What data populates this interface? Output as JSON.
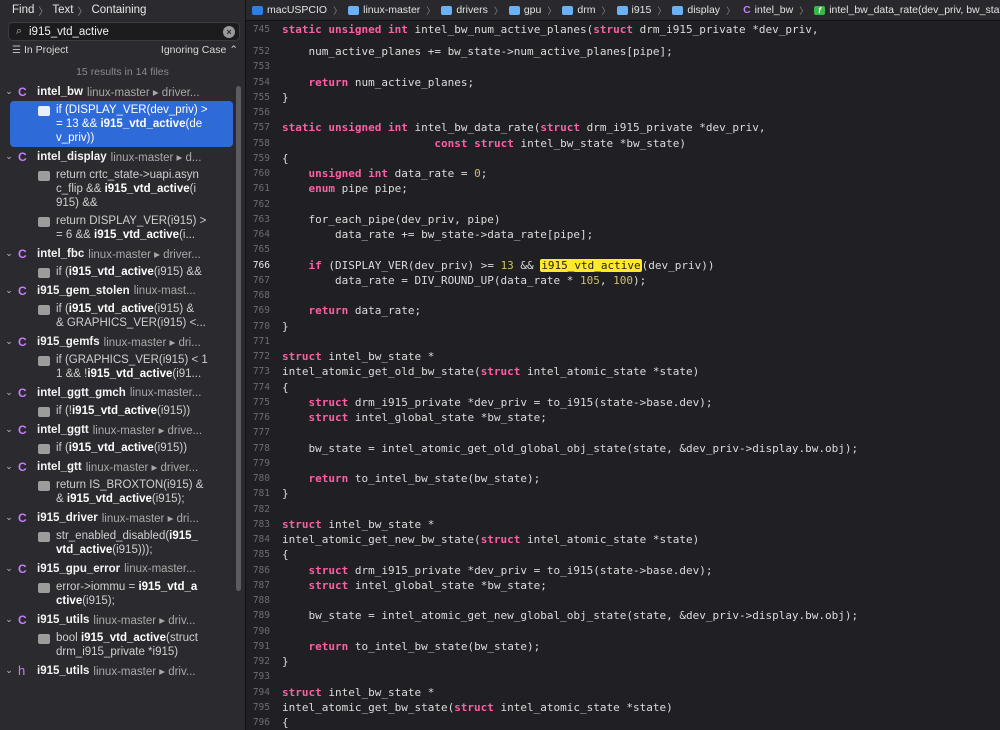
{
  "navigator": {
    "find_mode": [
      "Find",
      "Text",
      "Containing"
    ],
    "search_value": "i915_vtd_active",
    "scope": "In Project",
    "case_mode": "Ignoring Case ⌃",
    "results_count": "15 results in 14 files",
    "files": [
      {
        "badge": "C",
        "name": "intel_bw",
        "path": "linux-master ▸ driver...",
        "matches": [
          {
            "html": "if (DISPLAY_VER(dev_priv) >\n= 13 && <b>i915_vtd_active</b>(de\nv_priv))",
            "selected": true
          }
        ]
      },
      {
        "badge": "C",
        "name": "intel_display",
        "path": "linux-master ▸ d...",
        "matches": [
          {
            "html": "return crtc_state->uapi.asyn\nc_flip && <b>i915_vtd_active</b>(i\n915) &&"
          },
          {
            "html": "return DISPLAY_VER(i915) >\n= 6 && <b>i915_vtd_active</b>(i..."
          }
        ]
      },
      {
        "badge": "C",
        "name": "intel_fbc",
        "path": "linux-master ▸ driver...",
        "matches": [
          {
            "html": "if (<b>i915_vtd_active</b>(i915) &&"
          }
        ]
      },
      {
        "badge": "C",
        "name": "i915_gem_stolen",
        "path": "linux-mast...",
        "matches": [
          {
            "html": "if (<b>i915_vtd_active</b>(i915) &\n& GRAPHICS_VER(i915) <..."
          }
        ]
      },
      {
        "badge": "C",
        "name": "i915_gemfs",
        "path": "linux-master ▸ dri...",
        "matches": [
          {
            "html": "if (GRAPHICS_VER(i915) < 1\n1 && !<b>i915_vtd_active</b>(i91..."
          }
        ]
      },
      {
        "badge": "C",
        "name": "intel_ggtt_gmch",
        "path": "linux-master...",
        "matches": [
          {
            "html": "if (!<b>i915_vtd_active</b>(i915))"
          }
        ]
      },
      {
        "badge": "C",
        "name": "intel_ggtt",
        "path": "linux-master ▸ drive...",
        "matches": [
          {
            "html": "if (<b>i915_vtd_active</b>(i915))"
          }
        ]
      },
      {
        "badge": "C",
        "name": "intel_gtt",
        "path": "linux-master ▸ driver...",
        "matches": [
          {
            "html": "return IS_BROXTON(i915) &\n& <b>i915_vtd_active</b>(i915);"
          }
        ]
      },
      {
        "badge": "C",
        "name": "i915_driver",
        "path": "linux-master ▸ dri...",
        "matches": [
          {
            "html": "str_enabled_disabled(<b>i915_\nvtd_active</b>(i915)));"
          }
        ]
      },
      {
        "badge": "C",
        "name": "i915_gpu_error",
        "path": "linux-master...",
        "matches": [
          {
            "html": "error->iommu = <b>i915_vtd_a\nctive</b>(i915);"
          }
        ]
      },
      {
        "badge": "C",
        "name": "i915_utils",
        "path": "linux-master ▸ driv...",
        "matches": [
          {
            "html": "bool <b>i915_vtd_active</b>(struct\ndrm_i915_private *i915)"
          }
        ]
      },
      {
        "badge": "h",
        "name": "i915_utils",
        "path": "linux-master ▸ driv...",
        "matches": []
      }
    ]
  },
  "jumpbar": [
    {
      "kind": "proj",
      "label": "macUSPCIO"
    },
    {
      "kind": "fold",
      "label": "linux-master"
    },
    {
      "kind": "fold",
      "label": "drivers"
    },
    {
      "kind": "fold",
      "label": "gpu"
    },
    {
      "kind": "fold",
      "label": "drm"
    },
    {
      "kind": "fold",
      "label": "i915"
    },
    {
      "kind": "fold",
      "label": "display"
    },
    {
      "kind": "cfile",
      "label": "intel_bw"
    },
    {
      "kind": "func",
      "label": "intel_bw_data_rate(dev_priv, bw_state)"
    }
  ],
  "editor": {
    "current_line": "766",
    "lines": [
      {
        "n": "745",
        "html": "<span class=\"kw\">static</span> <span class=\"kw\">unsigned</span> <span class=\"kw\">int</span> intel_bw_num_active_planes(<span class=\"kw\">struct</span> drm_i915_private *dev_priv,"
      },
      {
        "n": "752",
        "html": "    num_active_planes += bw_state->num_active_planes[pipe];"
      },
      {
        "n": "753",
        "html": ""
      },
      {
        "n": "754",
        "html": "    <span class=\"kw\">return</span> num_active_planes;"
      },
      {
        "n": "755",
        "html": "}"
      },
      {
        "n": "756",
        "html": ""
      },
      {
        "n": "757",
        "html": "<span class=\"kw\">static</span> <span class=\"kw\">unsigned</span> <span class=\"kw\">int</span> intel_bw_data_rate(<span class=\"kw\">struct</span> drm_i915_private *dev_priv,"
      },
      {
        "n": "758",
        "html": "                       <span class=\"kw\">const</span> <span class=\"kw\">struct</span> intel_bw_state *bw_state)"
      },
      {
        "n": "759",
        "html": "{"
      },
      {
        "n": "760",
        "html": "    <span class=\"kw\">unsigned</span> <span class=\"kw\">int</span> data_rate = <span class=\"num\">0</span>;"
      },
      {
        "n": "761",
        "html": "    <span class=\"kw\">enum</span> pipe pipe;"
      },
      {
        "n": "762",
        "html": ""
      },
      {
        "n": "763",
        "html": "    for_each_pipe(dev_priv, pipe)"
      },
      {
        "n": "764",
        "html": "        data_rate += bw_state->data_rate[pipe];"
      },
      {
        "n": "765",
        "html": ""
      },
      {
        "n": "766",
        "html": "    <span class=\"kw\">if</span> (DISPLAY_VER(dev_priv) >= <span class=\"num\">13</span> && <span class=\"hl\">i915_vtd_active</span>(dev_priv))"
      },
      {
        "n": "767",
        "html": "        data_rate = DIV_ROUND_UP(data_rate * <span class=\"num\">105</span>, <span class=\"num\">100</span>);"
      },
      {
        "n": "768",
        "html": ""
      },
      {
        "n": "769",
        "html": "    <span class=\"kw\">return</span> data_rate;"
      },
      {
        "n": "770",
        "html": "}"
      },
      {
        "n": "771",
        "html": ""
      },
      {
        "n": "772",
        "html": "<span class=\"kw\">struct</span> intel_bw_state *"
      },
      {
        "n": "773",
        "html": "intel_atomic_get_old_bw_state(<span class=\"kw\">struct</span> intel_atomic_state *state)"
      },
      {
        "n": "774",
        "html": "{"
      },
      {
        "n": "775",
        "html": "    <span class=\"kw\">struct</span> drm_i915_private *dev_priv = to_i915(state->base.dev);"
      },
      {
        "n": "776",
        "html": "    <span class=\"kw\">struct</span> intel_global_state *bw_state;"
      },
      {
        "n": "777",
        "html": ""
      },
      {
        "n": "778",
        "html": "    bw_state = intel_atomic_get_old_global_obj_state(state, &dev_priv->display.bw.obj);"
      },
      {
        "n": "779",
        "html": ""
      },
      {
        "n": "780",
        "html": "    <span class=\"kw\">return</span> to_intel_bw_state(bw_state);"
      },
      {
        "n": "781",
        "html": "}"
      },
      {
        "n": "782",
        "html": ""
      },
      {
        "n": "783",
        "html": "<span class=\"kw\">struct</span> intel_bw_state *"
      },
      {
        "n": "784",
        "html": "intel_atomic_get_new_bw_state(<span class=\"kw\">struct</span> intel_atomic_state *state)"
      },
      {
        "n": "785",
        "html": "{"
      },
      {
        "n": "786",
        "html": "    <span class=\"kw\">struct</span> drm_i915_private *dev_priv = to_i915(state->base.dev);"
      },
      {
        "n": "787",
        "html": "    <span class=\"kw\">struct</span> intel_global_state *bw_state;"
      },
      {
        "n": "788",
        "html": ""
      },
      {
        "n": "789",
        "html": "    bw_state = intel_atomic_get_new_global_obj_state(state, &dev_priv->display.bw.obj);"
      },
      {
        "n": "790",
        "html": ""
      },
      {
        "n": "791",
        "html": "    <span class=\"kw\">return</span> to_intel_bw_state(bw_state);"
      },
      {
        "n": "792",
        "html": "}"
      },
      {
        "n": "793",
        "html": ""
      },
      {
        "n": "794",
        "html": "<span class=\"kw\">struct</span> intel_bw_state *"
      },
      {
        "n": "795",
        "html": "intel_atomic_get_bw_state(<span class=\"kw\">struct</span> intel_atomic_state *state)"
      },
      {
        "n": "796",
        "html": "{"
      }
    ]
  }
}
